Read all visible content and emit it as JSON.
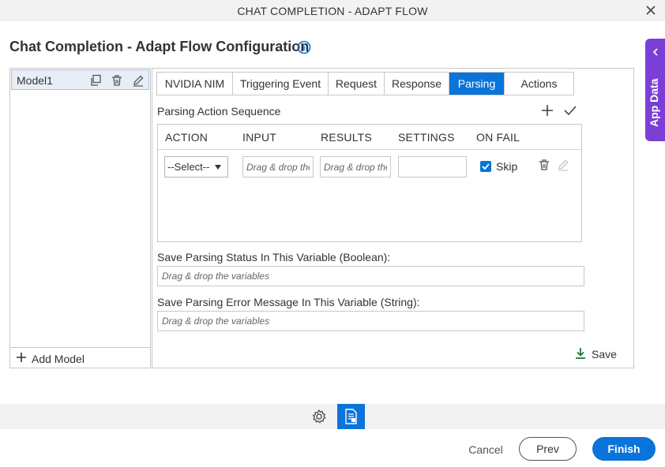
{
  "window": {
    "title": "CHAT COMPLETION - ADAPT FLOW",
    "close_icon": "close-icon"
  },
  "page": {
    "heading": "Chat Completion - Adapt Flow Configuration",
    "info_icon": "info-icon"
  },
  "app_data_panel": {
    "label": "App Data",
    "icon": "chevron-left-icon",
    "color": "#7b3fd6"
  },
  "models": {
    "items": [
      {
        "name": "Model1",
        "icons": [
          "copy-icon",
          "delete-icon",
          "edit-icon"
        ]
      }
    ],
    "add_label": "Add Model"
  },
  "tabs": [
    {
      "label": "NVIDIA NIM",
      "active": false
    },
    {
      "label": "Triggering Event",
      "active": false
    },
    {
      "label": "Request",
      "active": false
    },
    {
      "label": "Response",
      "active": false
    },
    {
      "label": "Parsing",
      "active": true
    },
    {
      "label": "Actions",
      "active": false
    }
  ],
  "parsing": {
    "title": "Parsing Action Sequence",
    "columns": [
      "ACTION",
      "INPUT",
      "RESULTS",
      "SETTINGS",
      "ON FAIL"
    ],
    "rows": [
      {
        "action": "--Select--",
        "input_placeholder": "Drag & drop the variables",
        "results_placeholder": "Drag & drop the variables",
        "settings": "",
        "on_fail_checked": true,
        "on_fail_label": "Skip"
      }
    ],
    "status_label": "Save Parsing Status In This Variable (Boolean):",
    "status_placeholder": "Drag & drop the variables",
    "error_label": "Save Parsing Error Message In This Variable (String):",
    "error_placeholder": "Drag & drop the variables",
    "save_label": "Save"
  },
  "footer": {
    "cancel": "Cancel",
    "prev": "Prev",
    "finish": "Finish"
  },
  "colors": {
    "accent": "#0a74da",
    "save_icon": "#1e7a34"
  }
}
